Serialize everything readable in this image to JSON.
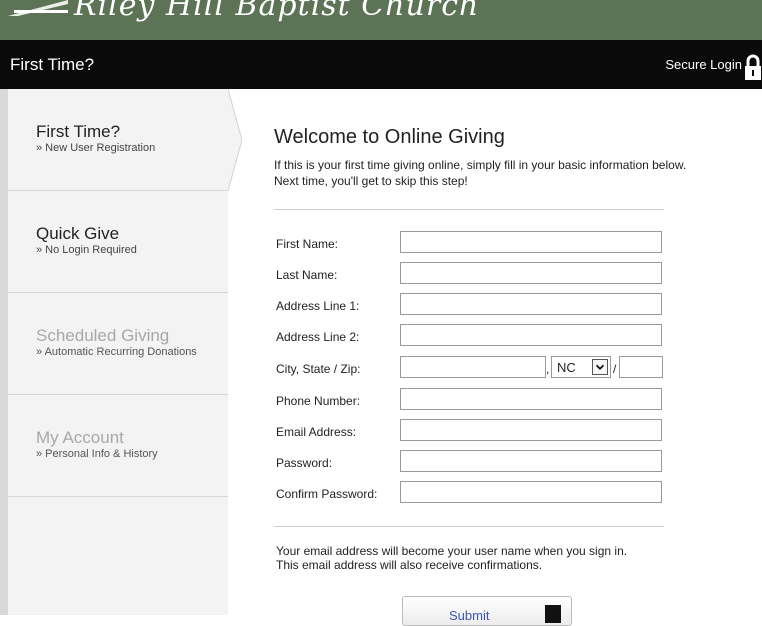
{
  "banner": {
    "church_name": "Riley Hill Baptist Church"
  },
  "header": {
    "title": "First Time?",
    "secure_login": "Secure Login"
  },
  "sidebar": {
    "items": [
      {
        "label": "First Time?",
        "sub": "» New User Registration",
        "state": "active"
      },
      {
        "label": "Quick Give",
        "sub": "» No Login Required",
        "state": "enabled"
      },
      {
        "label": "Scheduled Giving",
        "sub": "» Automatic Recurring Donations",
        "state": "disabled"
      },
      {
        "label": "My Account",
        "sub": "» Personal Info & History",
        "state": "disabled"
      }
    ]
  },
  "main": {
    "heading": "Welcome to Online Giving",
    "intro_line1": "If this is your first time giving online, simply fill in your basic information below.",
    "intro_line2": "Next time, you'll get to skip this step!",
    "form": {
      "first_name_label": "First Name:",
      "last_name_label": "Last Name:",
      "address1_label": "Address Line 1:",
      "address2_label": "Address Line 2:",
      "city_state_zip_label": "City, State / Zip:",
      "state_value": "NC",
      "comma": ",",
      "slash": "/",
      "phone_label": "Phone Number:",
      "email_label": "Email Address:",
      "password_label": "Password:",
      "confirm_password_label": "Confirm Password:"
    },
    "notice_line1": "Your email address will become your user name when you sign in.",
    "notice_line2": "This email address will also receive confirmations.",
    "submit_label": "Submit"
  },
  "colors": {
    "banner": "#5c7455",
    "header": "#0a0a0a",
    "sidebar_bg": "#f3f3f3",
    "disabled_text": "#a8a8a8",
    "submit_text": "#3b55b5"
  }
}
